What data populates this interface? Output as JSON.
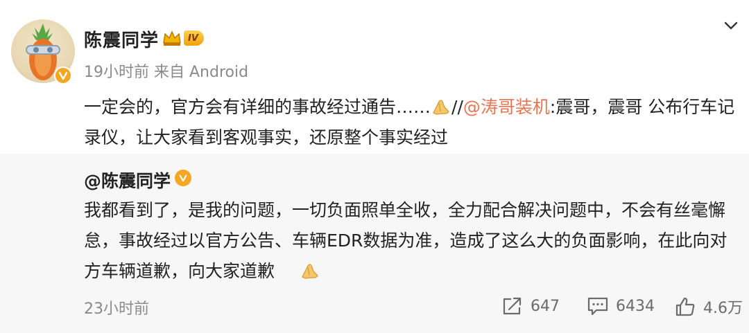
{
  "post": {
    "author": "陈震同学",
    "rank_level": "IV",
    "timestamp": "19小时前",
    "source": "来自 Android",
    "text_part1": "一定会的，官方会有详细的事故经过通告……",
    "text_sep": "//",
    "mention": "@涛哥装机",
    "text_part2": ":震哥，震哥 公布行车记录仪，让大家看到客观事实，还原整个事实经过"
  },
  "repost": {
    "author": "@陈震同学",
    "text": "我都看到了，是我的问题，一切负面照单全收，全力配合解决问题中，不会有丝毫懈怠，事故经过以官方公告、车辆EDR数据为准，造成了这么大的负面影响，在此向对方车辆道歉，向大家道歉",
    "timestamp": "23小时前",
    "reposts": "647",
    "comments": "6434",
    "likes": "4.6万"
  },
  "colors": {
    "mention": "#eb7350",
    "verified": "#f5a623",
    "repost_bg": "#f7f7f7",
    "meta": "#8a8a8a"
  },
  "icons": {
    "expand": "chevron-down-icon",
    "emoji": "pray-hands-emoji",
    "repost": "share-icon",
    "comment": "comment-icon",
    "like": "thumb-up-icon"
  }
}
